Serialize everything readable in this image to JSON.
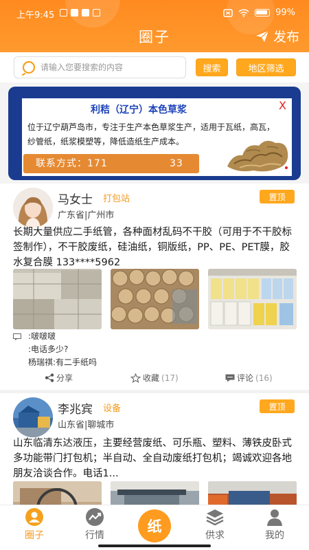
{
  "status": {
    "time": "上午9:45",
    "battery": "99%"
  },
  "header": {
    "title": "圈子",
    "publish_label": "发布"
  },
  "search": {
    "placeholder": "请输入您要搜索的内容",
    "search_label": "搜索",
    "region_label": "地区筛选"
  },
  "banner": {
    "title": "利秸（辽宁）本色草浆",
    "close": "X",
    "desc": "位于辽宁葫芦岛市，专注于生产本色草浆生产，适用于瓦纸，高瓦，纱管纸，纸浆模塑等，降低造纸生产成本。",
    "contact_prefix": "联系方式：171",
    "contact_suffix": "33"
  },
  "posts": [
    {
      "name": "马女士",
      "tag": "打包站",
      "location": "广东省|广州市",
      "pin_label": "置顶",
      "text": "长期大量供应二手纸管，各种面材乱码不干胶（可用于不干胶标签制作），不干胶废纸，硅油纸，铜版纸，PP、PE、PET膜，胶水复合膜 133****5962",
      "comments": [
        {
          "author": "",
          "text": ":啵啵啵"
        },
        {
          "author": "",
          "text": ":电话多少?"
        },
        {
          "author": "杨瑞祺",
          "text": ":有二手纸吗"
        }
      ],
      "share_label": "分享",
      "fav_label": "收藏",
      "fav_count": "(17)",
      "comment_label": "评论",
      "comment_count": "(16)"
    },
    {
      "name": "李兆宾",
      "tag": "设备",
      "location": "山东省|聊城市",
      "pin_label": "置顶",
      "text": "山东临清东达液压，主要经营废纸、可乐瓶、塑料、薄铁皮卧式多功能带门打包机；半自动、全自动废纸打包机；竭诚欢迎各地朋友洽谈合作。电话1..."
    }
  ],
  "nav": {
    "items": [
      "圈子",
      "行情",
      "供求",
      "我的"
    ],
    "center_label": "纸",
    "active": "圈子"
  },
  "colors": {
    "accent": "#ff9b1e",
    "banner_blue": "#1a3b8f"
  }
}
